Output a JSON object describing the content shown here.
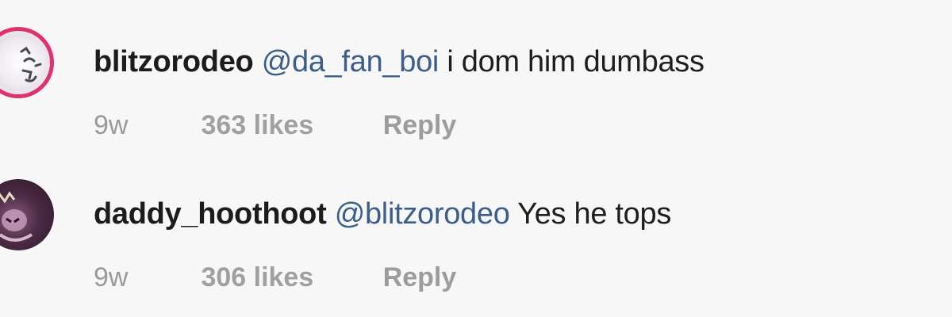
{
  "comments": [
    {
      "username": "blitzorodeo",
      "mention": "@da_fan_boi",
      "text": "i dom him dumbass",
      "time": "9w",
      "likes": "363 likes",
      "reply": "Reply",
      "avatar_icon": "profile-avatar-icon",
      "avatar_ring_color": "#e1306c"
    },
    {
      "username": "daddy_hoothoot",
      "mention": "@blitzorodeo",
      "text": "Yes he tops",
      "time": "9w",
      "likes": "306 likes",
      "reply": "Reply",
      "avatar_icon": "profile-avatar-icon"
    }
  ],
  "colors": {
    "mention": "#3b5f8a",
    "meta_text": "#9a9a9a",
    "background": "#f7f7f7"
  }
}
